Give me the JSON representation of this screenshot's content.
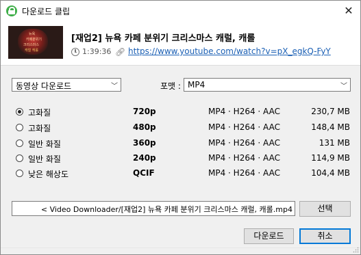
{
  "window": {
    "title": "다운로드 클립"
  },
  "video": {
    "title": "[재업2] 뉴욕 카페 분위기 크리스마스 캐럴, 캐롤",
    "duration": "1:39:36",
    "url": "https://www.youtube.com/watch?v=pX_egkQ-FyY"
  },
  "download_type": {
    "selected": "동영상 다운로드"
  },
  "format": {
    "label": "포맷 :",
    "selected": "MP4"
  },
  "qualities": [
    {
      "label": "고화질",
      "resolution": "720p",
      "format": "MP4 · H264 · AAC",
      "size": "230,7 MB",
      "checked": true
    },
    {
      "label": "고화질",
      "resolution": "480p",
      "format": "MP4 · H264 · AAC",
      "size": "148,4 MB",
      "checked": false
    },
    {
      "label": "일반 화질",
      "resolution": "360p",
      "format": "MP4 · H264 · AAC",
      "size": "131 MB",
      "checked": false
    },
    {
      "label": "일반 화질",
      "resolution": "240p",
      "format": "MP4 · H264 · AAC",
      "size": "114,9 MB",
      "checked": false
    },
    {
      "label": "낮은 해상도",
      "resolution": "QCIF",
      "format": "MP4 · H264 · AAC",
      "size": "104,4 MB",
      "checked": false
    }
  ],
  "output": {
    "path": "< Video Downloader/[재업2] 뉴욕 카페 분위기 크리스마스 캐럴, 캐롤.mp4",
    "browse_label": "선택"
  },
  "actions": {
    "download_label": "다운로드",
    "cancel_label": "취소"
  },
  "icons": {
    "app": "clip-download-icon",
    "close": "close-icon",
    "clock": "clock-icon",
    "link": "link-icon",
    "dropdown": "chevron-down-icon"
  },
  "colors": {
    "link": "#1a5fb4",
    "app_icon": "#3fae49",
    "primary_border": "#0078d7"
  }
}
